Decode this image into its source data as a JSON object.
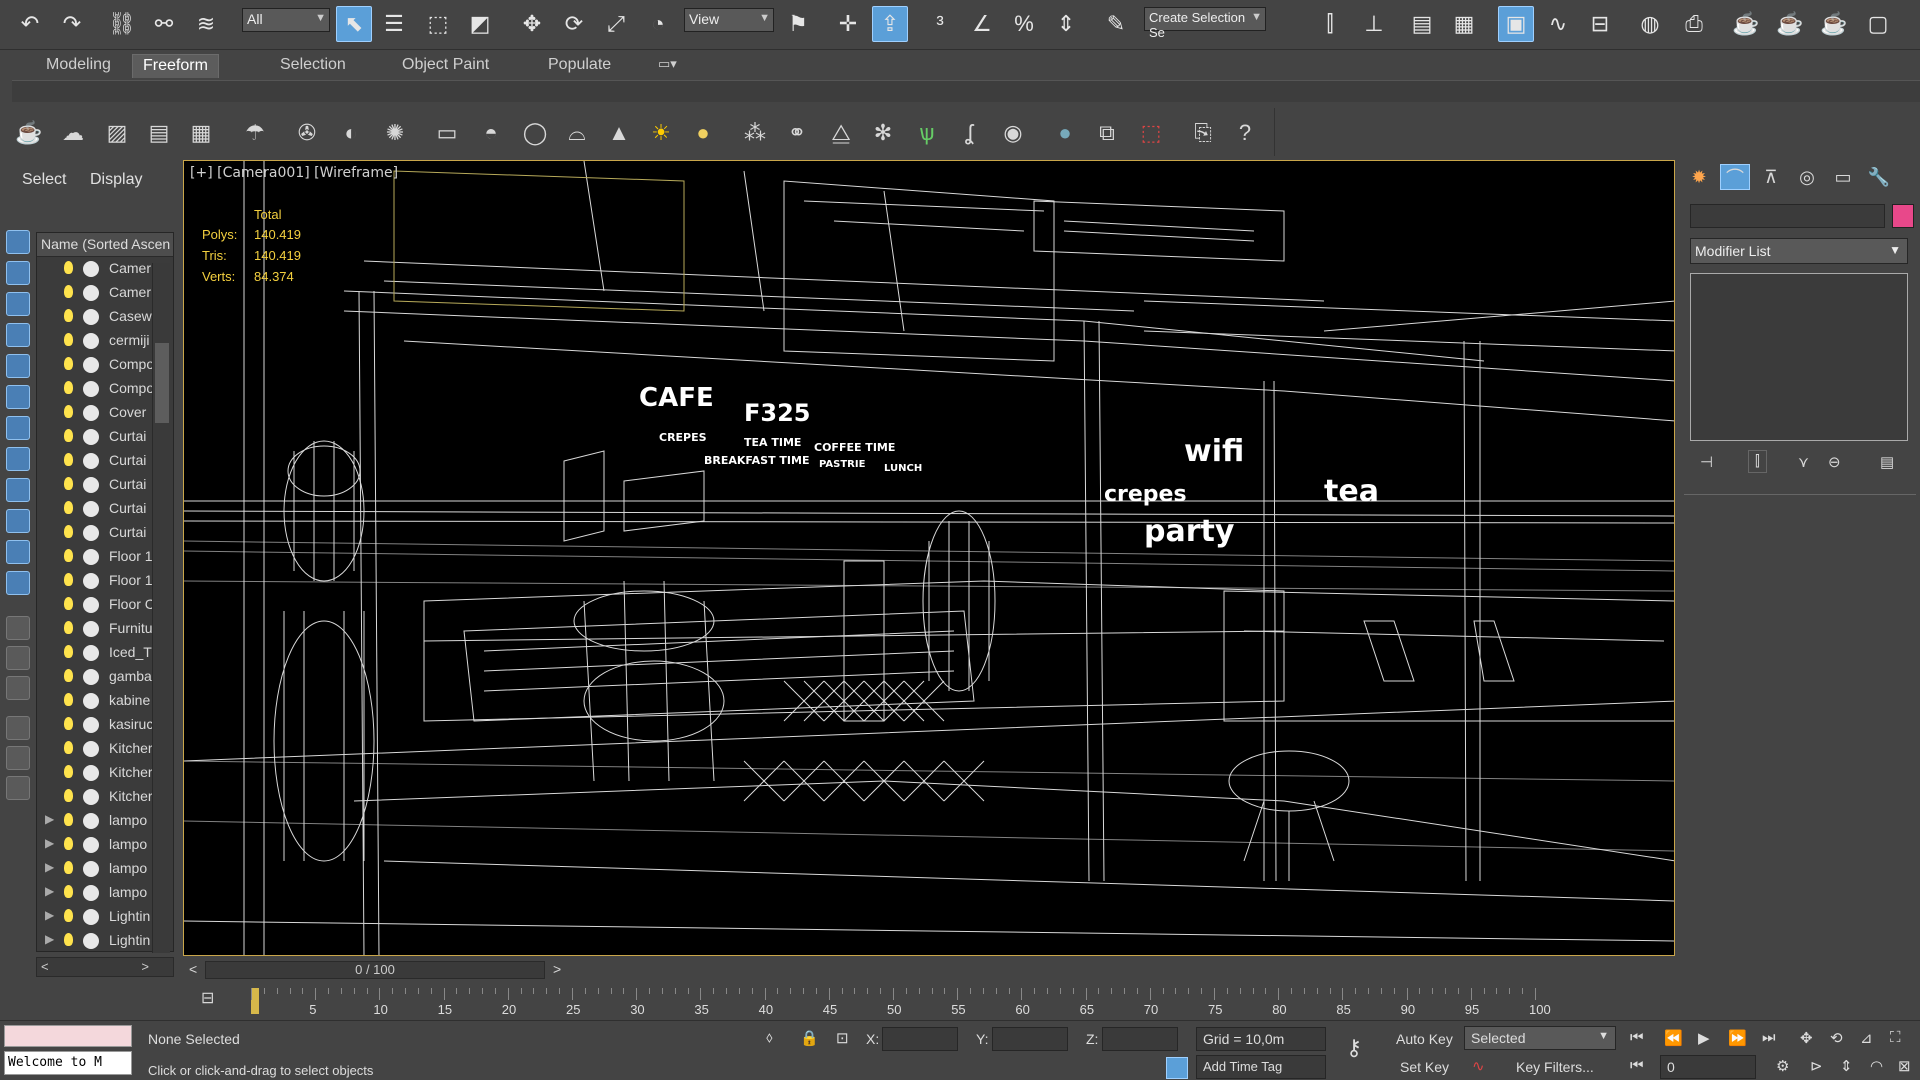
{
  "toolbar": {
    "selection_filter": "All",
    "ref_coord_system": "View",
    "named_selection_placeholder": "Create Selection Se"
  },
  "ribbon": {
    "tabs": [
      "Modeling",
      "Freeform",
      "Selection",
      "Object Paint",
      "Populate"
    ],
    "active_tab": "Freeform"
  },
  "scene_explorer": {
    "menu": [
      "Select",
      "Display"
    ],
    "column_header": "Name (Sorted Ascen",
    "items": [
      {
        "name": "Camer",
        "expand": ""
      },
      {
        "name": "Camer",
        "expand": ""
      },
      {
        "name": "Casew",
        "expand": ""
      },
      {
        "name": "cermiji",
        "expand": ""
      },
      {
        "name": "Compo",
        "expand": ""
      },
      {
        "name": "Compo",
        "expand": ""
      },
      {
        "name": "Cover",
        "expand": ""
      },
      {
        "name": "Curtai",
        "expand": ""
      },
      {
        "name": "Curtai",
        "expand": ""
      },
      {
        "name": "Curtai",
        "expand": ""
      },
      {
        "name": "Curtai",
        "expand": ""
      },
      {
        "name": "Curtai",
        "expand": ""
      },
      {
        "name": "Floor 1",
        "expand": ""
      },
      {
        "name": "Floor 1",
        "expand": ""
      },
      {
        "name": "Floor C",
        "expand": ""
      },
      {
        "name": "Furnitu",
        "expand": ""
      },
      {
        "name": "Iced_T",
        "expand": ""
      },
      {
        "name": "gamba",
        "expand": ""
      },
      {
        "name": "kabine",
        "expand": ""
      },
      {
        "name": "kasiruc",
        "expand": ""
      },
      {
        "name": "Kitcher",
        "expand": ""
      },
      {
        "name": "Kitcher",
        "expand": ""
      },
      {
        "name": "Kitcher",
        "expand": ""
      },
      {
        "name": "lampo",
        "expand": "▶"
      },
      {
        "name": "lampo",
        "expand": "▶"
      },
      {
        "name": "lampo",
        "expand": "▶"
      },
      {
        "name": "lampo",
        "expand": "▶"
      },
      {
        "name": "Lightin",
        "expand": "▶"
      },
      {
        "name": "Lightin",
        "expand": "▶"
      }
    ]
  },
  "viewport": {
    "label": "[+] [Camera001] [Wireframe]",
    "stats": {
      "header": "Total",
      "polys_label": "Polys:",
      "polys": "140.419",
      "tris_label": "Tris:",
      "tris": "140.419",
      "verts_label": "Verts:",
      "verts": "84.374"
    },
    "scene_text": [
      "CAFE",
      "F325",
      "CREPES",
      "TEA TIME",
      "COFFEE TIME",
      "BREAKFAST TIME",
      "PASTRIE",
      "LUNCH",
      "wifi",
      "crepes",
      "tea",
      "party"
    ]
  },
  "command_panel": {
    "modifier_list": "Modifier List",
    "color": "#e8488a"
  },
  "timeline": {
    "frame_display": "0 / 100",
    "ticks": [
      "5",
      "10",
      "15",
      "20",
      "25",
      "30",
      "35",
      "40",
      "45",
      "50",
      "55",
      "60",
      "65",
      "70",
      "75",
      "80",
      "85",
      "90",
      "95",
      "100"
    ]
  },
  "status": {
    "maxscript": "Welcome to M",
    "selection": "None Selected",
    "prompt": "Click or click-and-drag to select objects",
    "x_label": "X:",
    "y_label": "Y:",
    "z_label": "Z:",
    "grid": "Grid = 10,0m",
    "add_time_tag": "Add Time Tag",
    "auto_key": "Auto Key",
    "set_key": "Set Key",
    "key_mode": "Selected",
    "key_filters": "Key Filters...",
    "current_frame": "0"
  }
}
